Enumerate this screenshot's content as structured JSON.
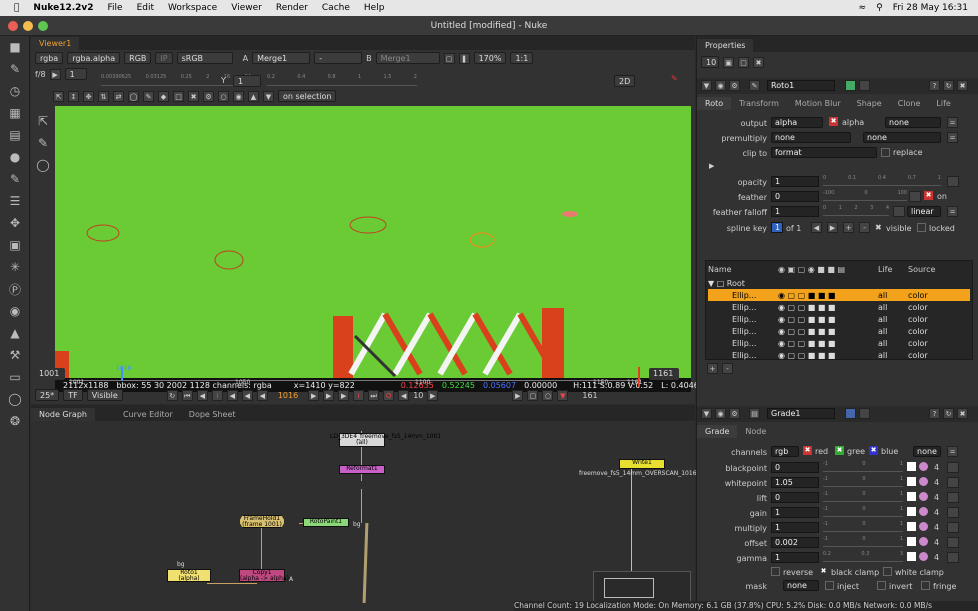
{
  "menubar": {
    "app": "Nuke12.2v2",
    "items": [
      "File",
      "Edit",
      "Workspace",
      "Viewer",
      "Render",
      "Cache",
      "Help"
    ],
    "clock": "Fri 28 May  16:31"
  },
  "window_title": "Untitled [modified] - Nuke",
  "viewer": {
    "tab": "Viewer1",
    "channels": "rgba",
    "layer": "rgba.alpha",
    "colorspace": "RGB",
    "ip": "IP",
    "lut": "sRGB",
    "a_input": "Merge1",
    "a_label": "A",
    "b_op": "-",
    "b_label": "B",
    "b_input": "Merge1",
    "zoom": "170%",
    "ratio": "1:1",
    "view_mode": "2D",
    "fstop": "f/8",
    "gain_val": "1",
    "y_label": "Y",
    "gamma_val": "1",
    "on_selection": "on selection",
    "gain_ticks": [
      "0.00390625",
      "0.03125",
      "0.25",
      "2",
      "16",
      "64"
    ],
    "gamma_ticks": [
      "0.2",
      "0.4",
      "0.8",
      "1",
      "1.5",
      "2"
    ],
    "info": {
      "res": "2112x1188",
      "bbox": "bbox: 55 30 2002 1128 channels: rgba",
      "coords": "x=1410 y=822",
      "r": "0.12635",
      "g": "0.52245",
      "b": "0.05607",
      "a": "0.00000",
      "hsv": "H:111 S:0.89 V:0.52",
      "lum": "L: 0.40466"
    },
    "timeline": {
      "start": "1001",
      "end": "1161",
      "current": "1016",
      "ticks": [
        "1001",
        "1050",
        "1100",
        "1150",
        "1161"
      ],
      "fps": "25*",
      "tf": "TF",
      "visible": "Visible",
      "frame": "1016",
      "step": "10",
      "end2": "161"
    }
  },
  "nodegraph": {
    "tabs": [
      "Node Graph",
      "Curve Editor",
      "Dope Sheet"
    ],
    "nodes": {
      "read": "LD_3DE4_freemove_fs5_14mm_1001",
      "read_sub": "(all)",
      "reformat": "Reformat1",
      "framehold": "FrameHold1",
      "framehold_sub": "(frame 1001)",
      "rotopaint": "RotoPaint1",
      "roto": "Roto1",
      "roto_sub": "(alpha)",
      "copy": "Copy1",
      "copy_sub": "(alpha -> alpha)",
      "write": "Write1",
      "write_sub": "freemove_fs5_14mm_OVERSCAN_1016",
      "bg": "bg",
      "a": "A"
    }
  },
  "properties": {
    "title": "Properties",
    "count": "10",
    "roto": {
      "name": "Roto1",
      "tabs": [
        "Roto",
        "Transform",
        "Motion Blur",
        "Shape",
        "Clone",
        "Life"
      ],
      "output_label": "output",
      "output": "alpha",
      "output_ch": "alpha",
      "output_none": "none",
      "premult_label": "premultiply",
      "premult": "none",
      "premult2": "none",
      "clipto_label": "clip to",
      "clipto": "format",
      "replace": "replace",
      "opacity_label": "opacity",
      "opacity": "1",
      "feather_label": "feather",
      "feather": "0",
      "feather_on": "on",
      "falloff_label": "feather falloff",
      "falloff": "1",
      "falloff_type": "linear",
      "splinekey_label": "spline key",
      "splinekey": "1",
      "of": "of 1",
      "visible": "visible",
      "locked": "locked",
      "opacity_ticks": [
        "0",
        "0.1",
        "0.4",
        "0.7",
        "1"
      ],
      "feather_ticks": [
        "-100",
        "0",
        "100"
      ],
      "falloff_ticks": [
        "0",
        "1",
        "2",
        "3",
        "4"
      ],
      "layer_cols": [
        "Name",
        "Life",
        "Source"
      ],
      "layers": [
        {
          "name": "Root",
          "life": "",
          "source": ""
        },
        {
          "name": "Ellip...",
          "life": "all",
          "source": "color"
        },
        {
          "name": "Ellip...",
          "life": "all",
          "source": "color"
        },
        {
          "name": "Ellip...",
          "life": "all",
          "source": "color"
        },
        {
          "name": "Ellip...",
          "life": "all",
          "source": "color"
        },
        {
          "name": "Ellip...",
          "life": "all",
          "source": "color"
        },
        {
          "name": "Ellip...",
          "life": "all",
          "source": "color"
        }
      ]
    },
    "grade": {
      "name": "Grade1",
      "tabs": [
        "Grade",
        "Node"
      ],
      "channels_label": "channels",
      "channels": "rgb",
      "red": "red",
      "green": "gree",
      "blue": "blue",
      "none": "none",
      "params": [
        {
          "label": "blackpoint",
          "value": "0"
        },
        {
          "label": "whitepoint",
          "value": "1.05"
        },
        {
          "label": "lift",
          "value": "0"
        },
        {
          "label": "gain",
          "value": "1"
        },
        {
          "label": "multiply",
          "value": "1"
        },
        {
          "label": "offset",
          "value": "0.002"
        },
        {
          "label": "gamma",
          "value": "1"
        }
      ],
      "slider_ticks": [
        "-1",
        "0",
        "1"
      ],
      "gamma_ticks": [
        "0.2",
        "0.3",
        "3"
      ],
      "count4": "4",
      "reverse": "reverse",
      "black_clamp": "black clamp",
      "white_clamp": "white clamp",
      "mask_label": "mask",
      "mask": "none",
      "inject": "inject",
      "invert": "invert",
      "fringe": "fringe"
    }
  },
  "status": "Channel Count: 19  Localization Mode: On  Memory: 6.1 GB (37.8%)  CPU: 5.2%  Disk: 0.0 MB/s  Network: 0.0 MB/s",
  "colors": {
    "accent": "#f0a030",
    "greenscreen": "#6acb34",
    "selected_row": "#f3a21b"
  }
}
